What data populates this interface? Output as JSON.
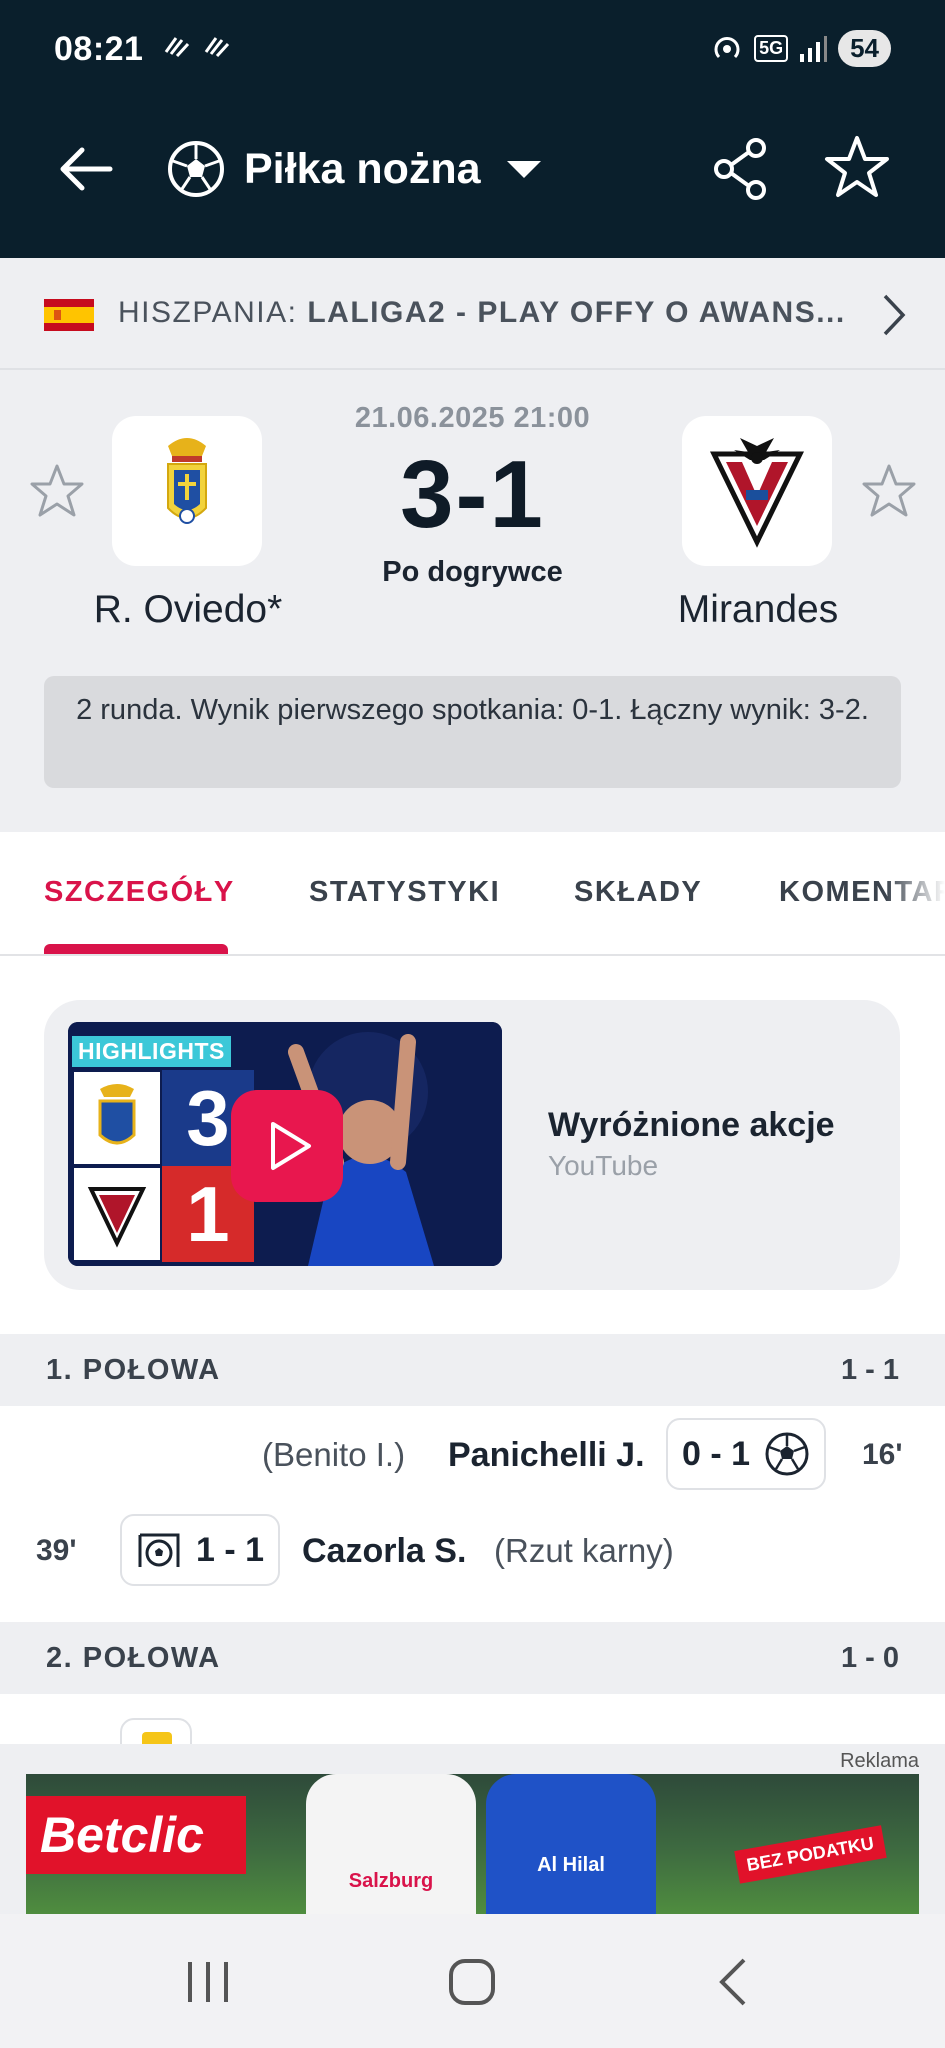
{
  "status_bar": {
    "time": "08:21",
    "network": "5G",
    "battery": "54"
  },
  "header": {
    "sport_label": "Piłka nożna"
  },
  "league": {
    "country": "HISZPANIA:",
    "name": "LALIGA2 - PLAY OFFY O AWANS..."
  },
  "match": {
    "date": "21.06.2025 21:00",
    "score": "3-1",
    "status": "Po dogrywce",
    "home_team": "R. Oviedo*",
    "away_team": "Mirandes",
    "info": "2 runda. Wynik pierwszego spotkania: 0-1. Łączny wynik: 3-2."
  },
  "tabs": [
    {
      "label": "SZCZEGÓŁY",
      "active": true
    },
    {
      "label": "STATYSTYKI"
    },
    {
      "label": "SKŁADY"
    },
    {
      "label": "KOMENTARZ"
    }
  ],
  "video": {
    "badge": "HIGHLIGHTS",
    "home_goals": "3",
    "away_goals": "1",
    "title": "Wyróżnione akcje",
    "source": "YouTube"
  },
  "periods": [
    {
      "label": "1. POŁOWA",
      "score": "1 - 1"
    },
    {
      "label": "2. POŁOWA",
      "score": "1 - 0"
    }
  ],
  "events": [
    {
      "minute": "16'",
      "score": "0 - 1",
      "player": "Panichelli J.",
      "extra": "(Benito I.)",
      "side": "away"
    },
    {
      "minute": "39'",
      "score": "1 - 1",
      "player": "Cazorla S.",
      "extra": "(Rzut karny)",
      "side": "home"
    }
  ],
  "ad": {
    "label": "Reklama",
    "brand": "Betclic",
    "shirt1_text": "Salzburg",
    "shirt2_text": "Al Hilal",
    "badge": "BEZ PODATKU"
  },
  "colors": {
    "header_bg": "#0a1f2c",
    "accent": "#d9134a",
    "page_bg": "#eeeff2"
  }
}
